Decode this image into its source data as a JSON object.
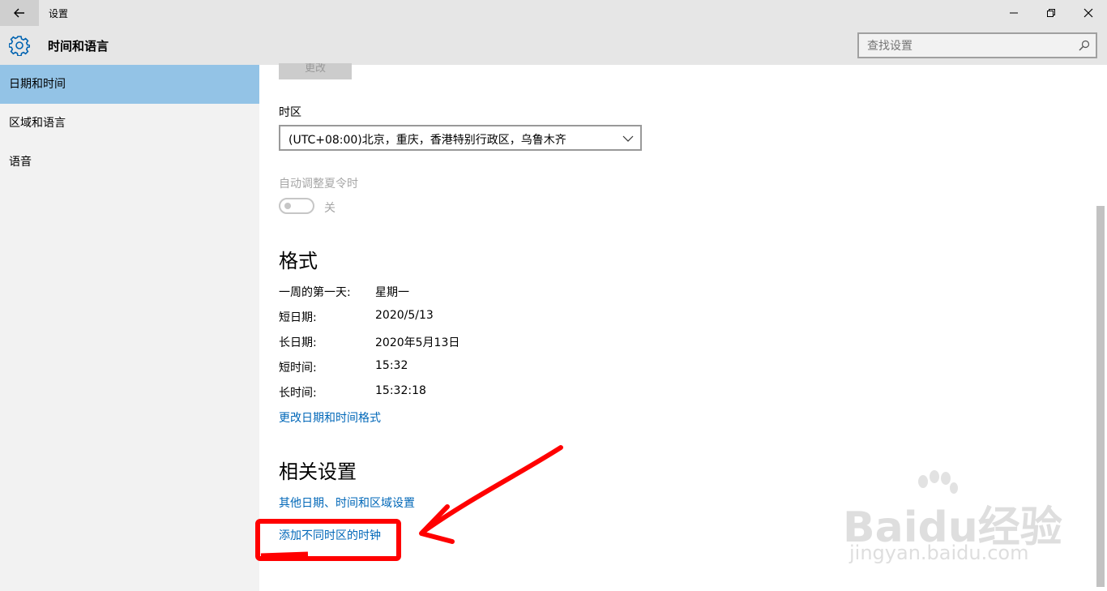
{
  "window": {
    "title": "设置",
    "back_icon": "back-arrow-icon",
    "controls": [
      "minimize-icon",
      "restore-icon",
      "close-icon"
    ]
  },
  "header": {
    "icon": "gear-icon",
    "title": "时间和语言",
    "search_placeholder": "查找设置"
  },
  "sidebar": {
    "items": [
      {
        "label": "日期和时间",
        "active": true
      },
      {
        "label": "区域和语言",
        "active": false
      },
      {
        "label": "语音",
        "active": false
      }
    ]
  },
  "main": {
    "change_button": "更改",
    "timezone": {
      "label": "时区",
      "value": "(UTC+08:00)北京，重庆，香港特别行政区，乌鲁木齐"
    },
    "dst": {
      "label": "自动调整夏令时",
      "state": "关"
    },
    "format": {
      "heading": "格式",
      "rows": [
        {
          "key": "一周的第一天:",
          "value": "星期一"
        },
        {
          "key": "短日期:",
          "value": "2020/5/13"
        },
        {
          "key": "长日期:",
          "value": "2020年5月13日"
        },
        {
          "key": "短时间:",
          "value": "15:32"
        },
        {
          "key": "长时间:",
          "value": "15:32:18"
        }
      ],
      "link": "更改日期和时间格式"
    },
    "related": {
      "heading": "相关设置",
      "links": [
        "其他日期、时间和区域设置",
        "添加不同时区的时钟"
      ]
    }
  },
  "colors": {
    "sidebar_active": "#93c3e6",
    "link": "#0067b8",
    "annotation": "#ff0000"
  },
  "watermark": {
    "brand": "Baidu经验",
    "sub": "jingyan.baidu.com"
  }
}
